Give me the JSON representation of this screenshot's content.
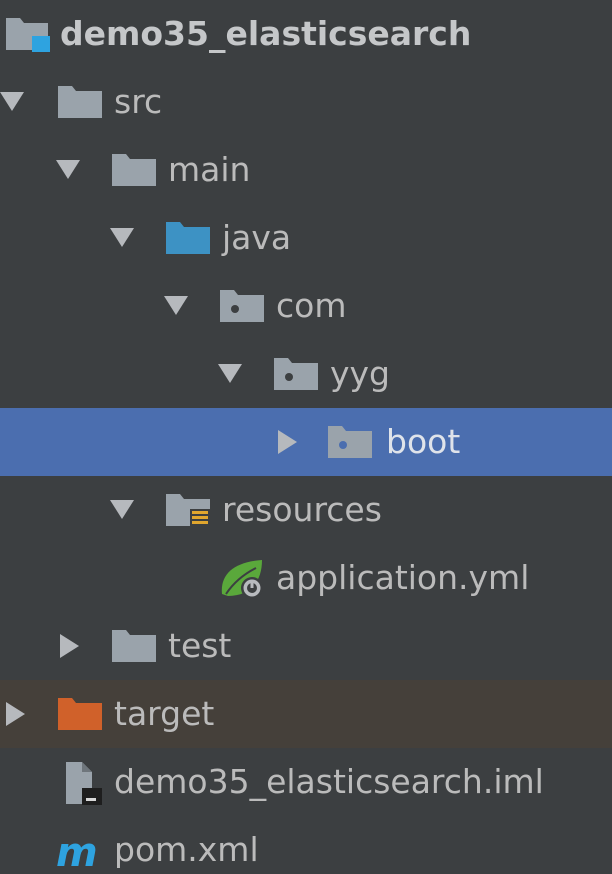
{
  "tree": {
    "project": {
      "label": "demo35_elasticsearch",
      "icon": "project-module-icon"
    },
    "src": {
      "label": "src",
      "icon": "folder-icon"
    },
    "main": {
      "label": "main",
      "icon": "folder-icon"
    },
    "java": {
      "label": "java",
      "icon": "source-root-folder-icon"
    },
    "com": {
      "label": "com",
      "icon": "package-icon"
    },
    "yyg": {
      "label": "yyg",
      "icon": "package-icon"
    },
    "boot": {
      "label": "boot",
      "icon": "package-icon",
      "selected": true
    },
    "resources": {
      "label": "resources",
      "icon": "resources-root-folder-icon"
    },
    "application_yml": {
      "label": "application.yml",
      "icon": "spring-boot-config-icon"
    },
    "test": {
      "label": "test",
      "icon": "folder-icon"
    },
    "target": {
      "label": "target",
      "icon": "excluded-folder-icon"
    },
    "iml": {
      "label": "demo35_elasticsearch.iml",
      "icon": "iml-file-icon"
    },
    "pom": {
      "label": "pom.xml",
      "icon": "maven-icon"
    }
  },
  "colors": {
    "background": "#3c3f41",
    "selection": "#4b6eaf",
    "excluded_row": "#45403a",
    "folder": "#9aa3ab",
    "source_root": "#3d92c4",
    "excluded_folder": "#d0612a",
    "resources_marker": "#e0a62e",
    "spring_green": "#5aa83b",
    "maven": "#2ea3e0",
    "text": "#bbbbbb"
  }
}
